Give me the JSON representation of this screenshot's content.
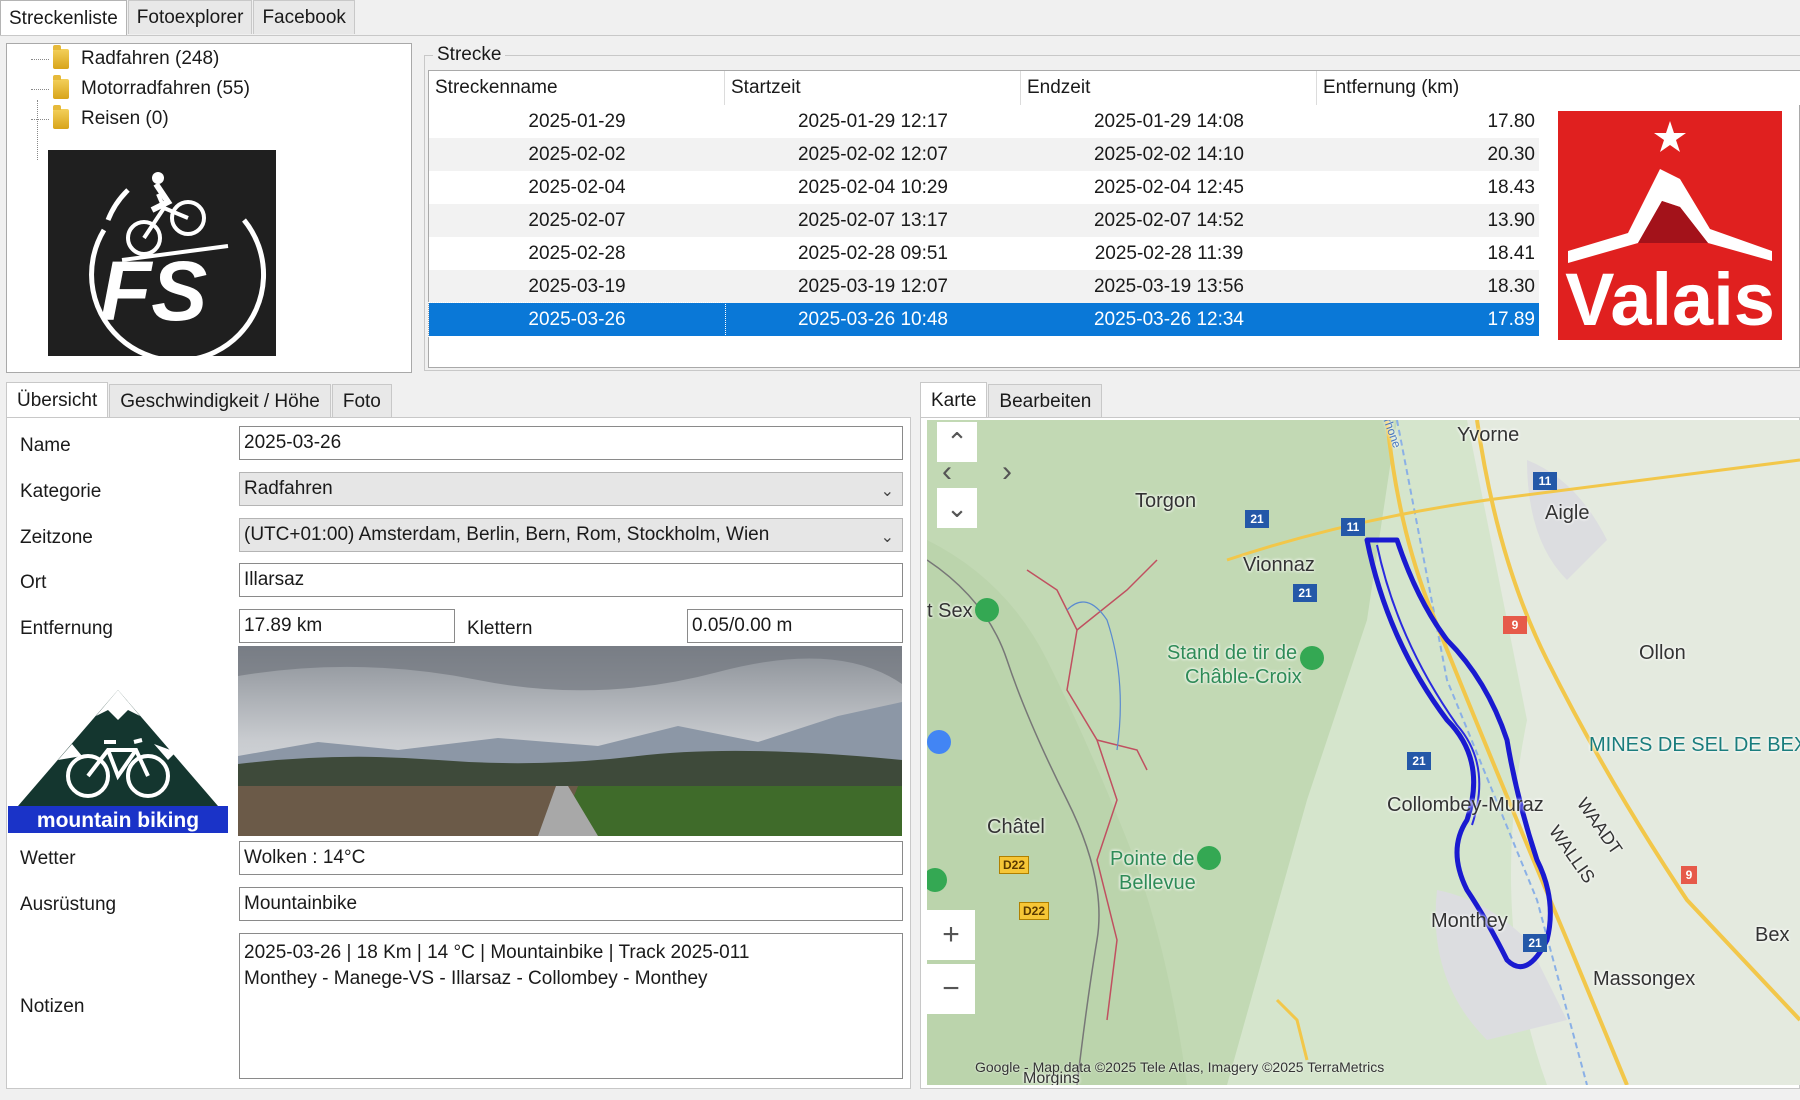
{
  "top_tabs": [
    "Streckenliste",
    "Fotoexplorer",
    "Facebook"
  ],
  "categories": [
    {
      "label": "Radfahren (248)"
    },
    {
      "label": "Motorradfahren (55)"
    },
    {
      "label": "Reisen (0)"
    }
  ],
  "route_group": {
    "label": "Strecke",
    "columns": [
      "Streckenname",
      "Startzeit",
      "Endzeit",
      "Entfernung (km)"
    ],
    "rows": [
      {
        "name": "2025-01-29",
        "start": "2025-01-29 12:17",
        "end": "2025-01-29 14:08",
        "dist": "17.80"
      },
      {
        "name": "2025-02-02",
        "start": "2025-02-02 12:07",
        "end": "2025-02-02 14:10",
        "dist": "20.30"
      },
      {
        "name": "2025-02-04",
        "start": "2025-02-04 10:29",
        "end": "2025-02-04 12:45",
        "dist": "18.43"
      },
      {
        "name": "2025-02-07",
        "start": "2025-02-07 13:17",
        "end": "2025-02-07 14:52",
        "dist": "13.90"
      },
      {
        "name": "2025-02-28",
        "start": "2025-02-28 09:51",
        "end": "2025-02-28 11:39",
        "dist": "18.41"
      },
      {
        "name": "2025-03-19",
        "start": "2025-03-19 12:07",
        "end": "2025-03-19 13:56",
        "dist": "18.30"
      },
      {
        "name": "2025-03-26",
        "start": "2025-03-26 10:48",
        "end": "2025-03-26 12:34",
        "dist": "17.89"
      }
    ],
    "selected_index": 6
  },
  "logos": {
    "valais": "Valais",
    "mtb": "mountain biking"
  },
  "detail_tabs": [
    "Übersicht",
    "Geschwindigkeit / Höhe",
    "Foto"
  ],
  "form": {
    "name_label": "Name",
    "name": "2025-03-26",
    "kategorie_label": "Kategorie",
    "kategorie": "Radfahren",
    "zeitzone_label": "Zeitzone",
    "zeitzone": "(UTC+01:00) Amsterdam, Berlin, Bern, Rom, Stockholm, Wien",
    "ort_label": "Ort",
    "ort": "Illarsaz",
    "entfernung_label": "Entfernung",
    "entfernung": "17.89 km",
    "klettern_label": "Klettern",
    "klettern": "0.05/0.00 m",
    "wetter_label": "Wetter",
    "wetter": "Wolken  :  14°C",
    "ausruestung_label": "Ausrüstung",
    "ausruestung": "Mountainbike",
    "notizen_label": "Notizen",
    "notizen_line1": "2025-03-26  |  18 Km  |  14 °C  |  Mountainbike  |  Track 2025-011",
    "notizen_line2": "Monthey - Manege-VS - Illarsaz - Collombey - Monthey"
  },
  "map_tabs": [
    "Karte",
    "Bearbeiten"
  ],
  "map": {
    "places": {
      "yvorne": "Yvorne",
      "torgon": "Torgon",
      "aigle": "Aigle",
      "vionnaz": "Vionnaz",
      "sex": "t Sex",
      "stand": "Stand de tir de",
      "stand2": "Châble-Croix",
      "ollon": "Ollon",
      "mines": "MINES DE SEL DE BEX",
      "collombey": "Collombey-Muraz",
      "chatel": "Châtel",
      "pointe": "Pointe de",
      "pointe2": "Bellevue",
      "monthey": "Monthey",
      "bex": "Bex",
      "massongex": "Massongex",
      "morgins": "Morgins",
      "waadt": "WAADT",
      "wallis": "WALLIS",
      "rhone": "rhone"
    },
    "shields": [
      "11",
      "21",
      "11",
      "21",
      "9",
      "21",
      "21",
      "D22",
      "D22",
      "9"
    ],
    "attribution": "Google - Map data ©2025 Tele Atlas, Imagery ©2025 TerraMetrics",
    "zoom_in": "+",
    "zoom_out": "−"
  },
  "colors": {
    "selection": "#0a78d7",
    "valais_red": "#e0201f",
    "track": "#1a1ad0"
  }
}
